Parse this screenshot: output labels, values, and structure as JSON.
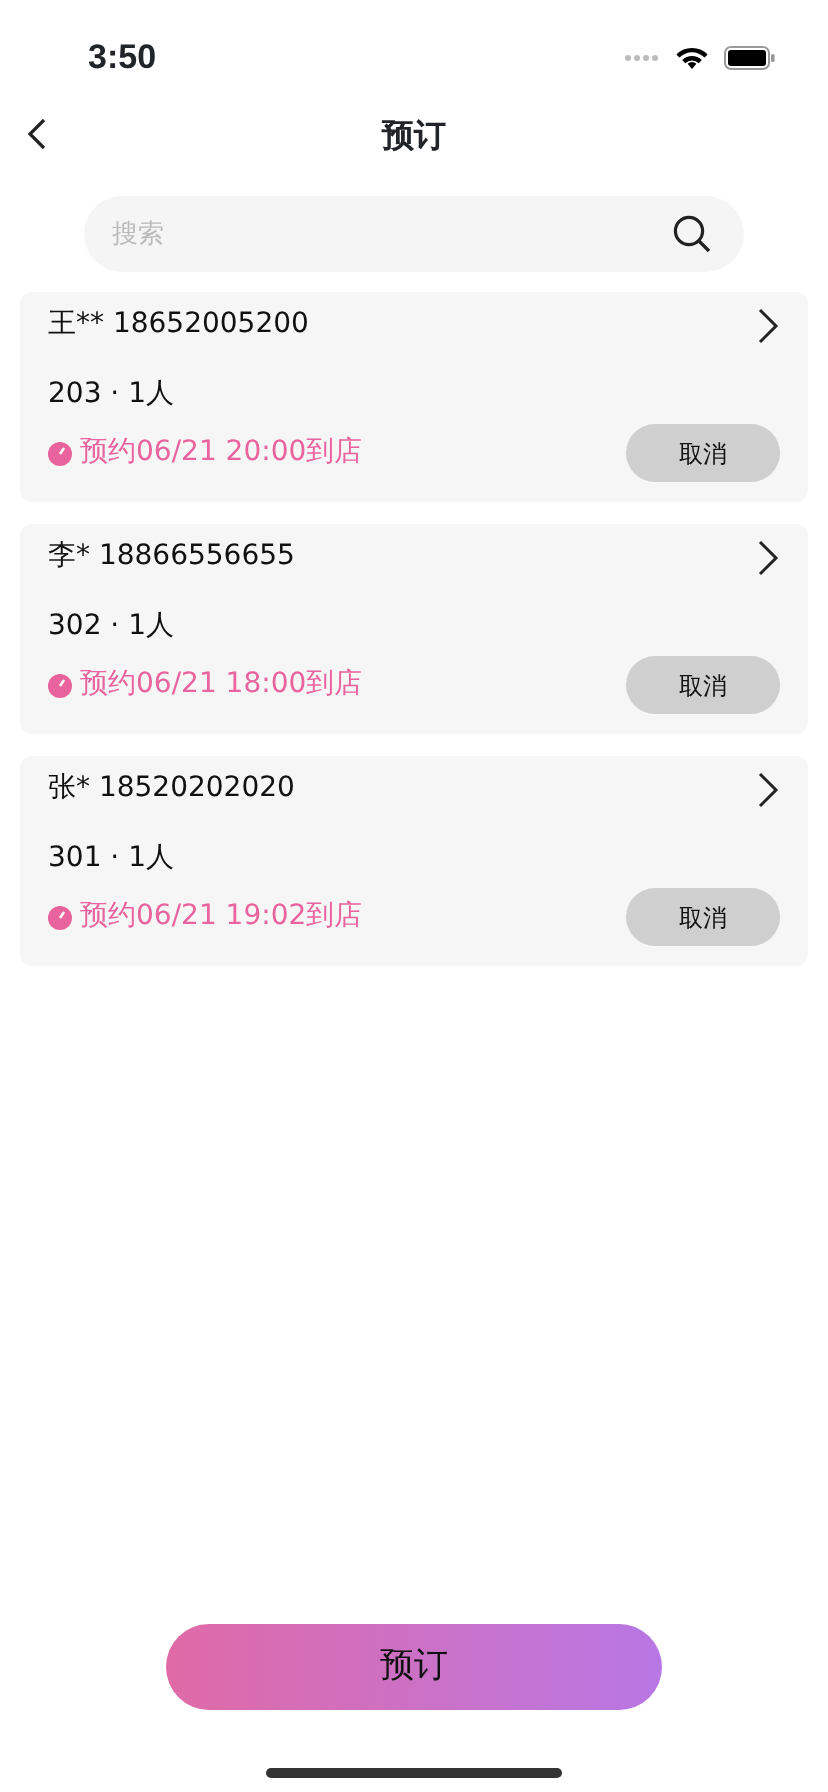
{
  "status_bar": {
    "time": "3:50"
  },
  "nav": {
    "title": "预订"
  },
  "search": {
    "placeholder": "搜索"
  },
  "bookings": [
    {
      "name": "王** 18652005200",
      "detail": "203 · 1人",
      "appointment": "预约06/21 20:00到店",
      "action": "取消"
    },
    {
      "name": "李* 18866556655",
      "detail": "302 · 1人",
      "appointment": "预约06/21 18:00到店",
      "action": "取消"
    },
    {
      "name": "张* 18520202020",
      "detail": "301 · 1人",
      "appointment": "预约06/21 19:02到店",
      "action": "取消"
    }
  ],
  "primary_button": "预订"
}
